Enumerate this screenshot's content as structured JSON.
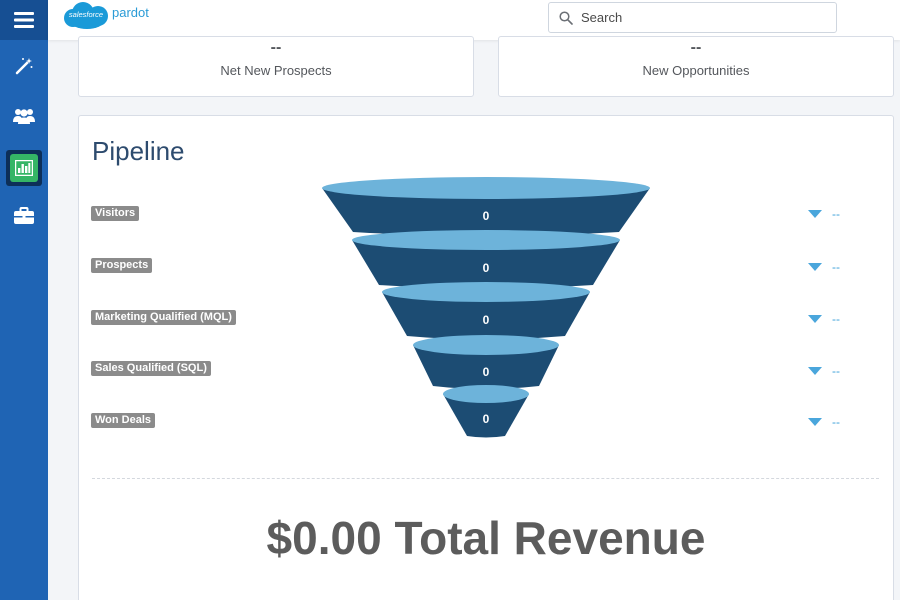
{
  "sidebar": {
    "menu_icon": "hamburger-icon",
    "items": [
      {
        "icon": "magic-wand-icon",
        "active": false
      },
      {
        "icon": "users-icon",
        "active": false
      },
      {
        "icon": "reports-chart-icon",
        "active": true
      },
      {
        "icon": "briefcase-icon",
        "active": false
      }
    ]
  },
  "header": {
    "logo_badge": "salesforce",
    "brand": "pardot",
    "search_placeholder": "Search"
  },
  "metrics": [
    {
      "value": "--",
      "label": "Net New Prospects"
    },
    {
      "value": "--",
      "label": "New Opportunities"
    }
  ],
  "pipeline": {
    "title": "Pipeline",
    "stages": [
      {
        "label": "Visitors",
        "count": "0",
        "change": "--"
      },
      {
        "label": "Prospects",
        "count": "0",
        "change": "--"
      },
      {
        "label": "Marketing Qualified (MQL)",
        "count": "0",
        "change": "--"
      },
      {
        "label": "Sales Qualified (SQL)",
        "count": "0",
        "change": "--"
      },
      {
        "label": "Won Deals",
        "count": "0",
        "change": "--"
      }
    ],
    "total_revenue": "$0.00 Total Revenue"
  },
  "colors": {
    "sidebar": "#1f64b4",
    "funnel_top": "#6db3da",
    "funnel_body": "#1c4c73",
    "accent": "#3ba0d9"
  }
}
